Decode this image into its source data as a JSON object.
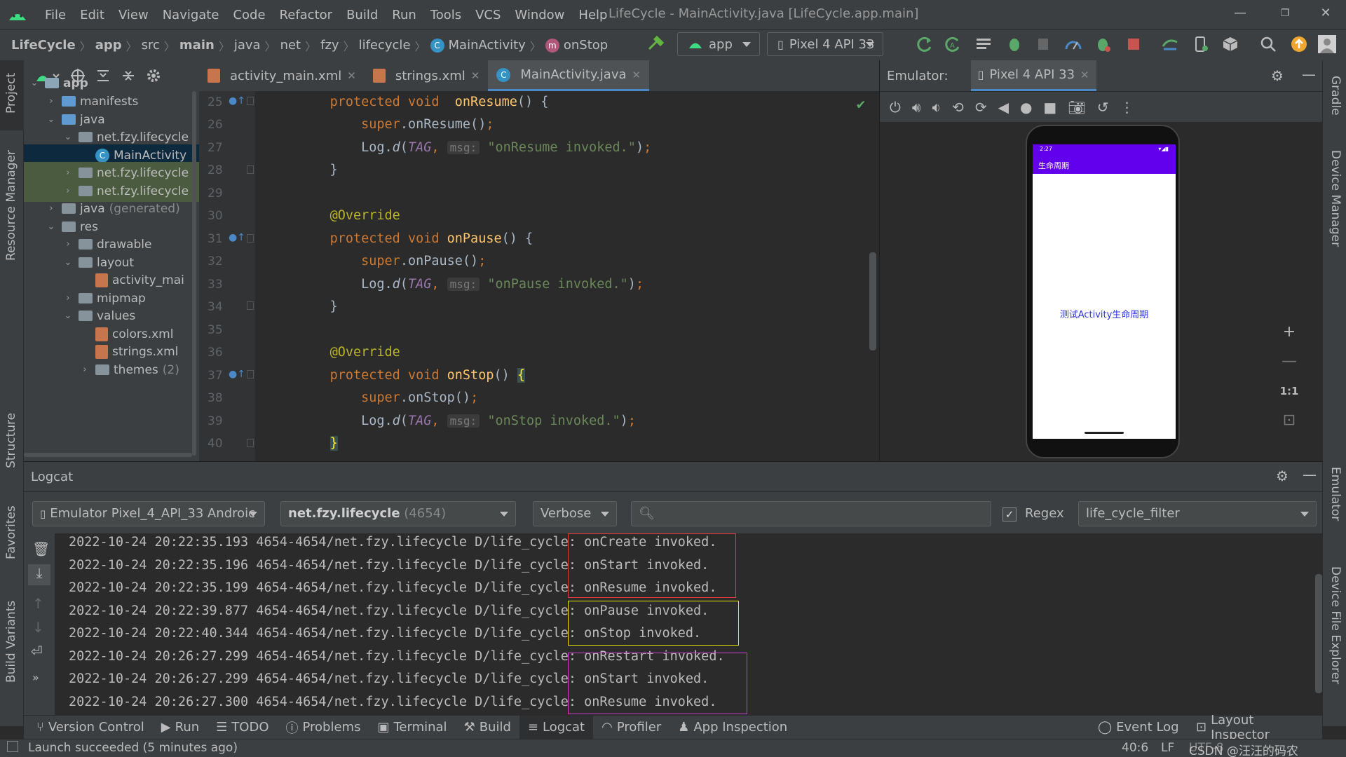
{
  "menubar": {
    "items": [
      "File",
      "Edit",
      "View",
      "Navigate",
      "Code",
      "Refactor",
      "Build",
      "Run",
      "Tools",
      "VCS",
      "Window",
      "Help"
    ],
    "title": "LifeCycle - MainActivity.java [LifeCycle.app.main]"
  },
  "navbar": {
    "crumbs": [
      "LifeCycle",
      "app",
      "src",
      "main",
      "java",
      "net",
      "fzy",
      "lifecycle",
      "MainActivity",
      "onStop"
    ],
    "run_config": "app",
    "device": "Pixel 4 API 33"
  },
  "project": {
    "tree": [
      {
        "label": "app",
        "depth": 0,
        "open": true,
        "kind": "module"
      },
      {
        "label": "manifests",
        "depth": 1,
        "open": false,
        "kind": "folder-blue"
      },
      {
        "label": "java",
        "depth": 1,
        "open": true,
        "kind": "folder-blue"
      },
      {
        "label": "net.fzy.lifecycle",
        "depth": 2,
        "open": true,
        "kind": "folder"
      },
      {
        "label": "MainActivity",
        "depth": 3,
        "kind": "class"
      },
      {
        "label": "net.fzy.lifecycle",
        "depth": 2,
        "open": false,
        "kind": "folder"
      },
      {
        "label": "net.fzy.lifecycle",
        "depth": 2,
        "open": false,
        "kind": "folder"
      },
      {
        "label": "java",
        "suffix": "(generated)",
        "depth": 1,
        "open": false,
        "kind": "folder-gen"
      },
      {
        "label": "res",
        "depth": 1,
        "open": true,
        "kind": "folder"
      },
      {
        "label": "drawable",
        "depth": 2,
        "open": false,
        "kind": "folder"
      },
      {
        "label": "layout",
        "depth": 2,
        "open": true,
        "kind": "folder"
      },
      {
        "label": "activity_mai",
        "depth": 3,
        "kind": "xml"
      },
      {
        "label": "mipmap",
        "depth": 2,
        "open": false,
        "kind": "folder"
      },
      {
        "label": "values",
        "depth": 2,
        "open": true,
        "kind": "folder"
      },
      {
        "label": "colors.xml",
        "depth": 3,
        "kind": "xml"
      },
      {
        "label": "strings.xml",
        "depth": 3,
        "kind": "xml"
      },
      {
        "label": "themes",
        "suffix": "(2)",
        "depth": 3,
        "open": false,
        "kind": "folder"
      }
    ]
  },
  "editor": {
    "tabs": [
      {
        "label": "activity_main.xml",
        "active": false
      },
      {
        "label": "strings.xml",
        "active": false
      },
      {
        "label": "MainActivity.java",
        "active": true
      }
    ],
    "line_numbers": [
      "25",
      "26",
      "27",
      "28",
      "29",
      "30",
      "31",
      "32",
      "33",
      "34",
      "35",
      "36",
      "37",
      "38",
      "39",
      "40"
    ]
  },
  "emulator": {
    "label": "Emulator:",
    "tab": "Pixel 4 API 33",
    "app_title": "生命周期",
    "status_time": "2:27",
    "content_text": "测试Activity生命周期",
    "zoom_labels": [
      "+",
      "—",
      "1:1",
      "⊡"
    ]
  },
  "logcat": {
    "title": "Logcat",
    "device_filter": "Emulator Pixel_4_API_33 Androic",
    "process_filter_pkg": "net.fzy.lifecycle",
    "process_filter_pid": "(4654)",
    "level": "Verbose",
    "search_placeholder": "",
    "regex_label": "Regex",
    "saved_filter": "life_cycle_filter",
    "lines": [
      {
        "prefix": "2022-10-24 20:22:35.193 4654-4654/net.fzy.lifecycle D/life_cycle:",
        "msg": "onCreate invoked."
      },
      {
        "prefix": "2022-10-24 20:22:35.196 4654-4654/net.fzy.lifecycle D/life_cycle:",
        "msg": "onStart invoked."
      },
      {
        "prefix": "2022-10-24 20:22:35.199 4654-4654/net.fzy.lifecycle D/life_cycle:",
        "msg": "onResume invoked."
      },
      {
        "prefix": "2022-10-24 20:22:39.877 4654-4654/net.fzy.lifecycle D/life_cycle:",
        "msg": "onPause invoked."
      },
      {
        "prefix": "2022-10-24 20:22:40.344 4654-4654/net.fzy.lifecycle D/life_cycle:",
        "msg": "onStop invoked."
      },
      {
        "prefix": "2022-10-24 20:26:27.299 4654-4654/net.fzy.lifecycle D/life_cycle:",
        "msg": "onRestart invoked."
      },
      {
        "prefix": "2022-10-24 20:26:27.299 4654-4654/net.fzy.lifecycle D/life_cycle:",
        "msg": "onStart invoked."
      },
      {
        "prefix": "2022-10-24 20:26:27.300 4654-4654/net.fzy.lifecycle D/life_cycle:",
        "msg": "onResume invoked."
      }
    ],
    "box_colors": {
      "create": "#e03c3c",
      "pause": "#e6e600",
      "restart": "#d23cd2"
    }
  },
  "bottom_tools": [
    "Version Control",
    "Run",
    "TODO",
    "Problems",
    "Terminal",
    "Build",
    "Logcat",
    "Profiler",
    "App Inspection"
  ],
  "bottom_right_tools": [
    "Event Log",
    "Layout Inspector"
  ],
  "left_strip": [
    "Project",
    "Resource Manager",
    "Structure",
    "Favorites",
    "Build Variants"
  ],
  "right_strip": [
    "Gradle",
    "Device Manager",
    "Emulator",
    "Device File Explorer"
  ],
  "status": {
    "message": "Launch succeeded (5 minutes ago)",
    "position": "40:6",
    "line_sep": "LF",
    "encoding": "UTF-8",
    "watermark": "CSDN @汪汪的码农"
  }
}
